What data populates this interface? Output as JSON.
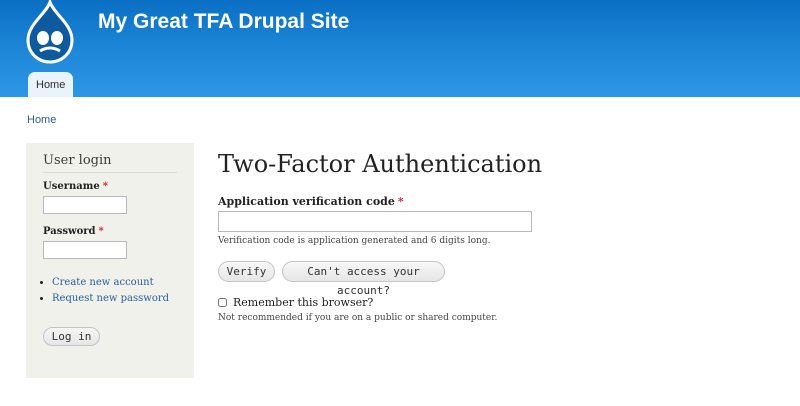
{
  "header": {
    "site_name": "My Great TFA Drupal Site",
    "logo_icon": "drupal-drop-logo-icon",
    "nav": {
      "home_tab": "Home"
    },
    "colors": {
      "gradient_top": "#0a6fc4",
      "gradient_bottom": "#2d97e6"
    }
  },
  "breadcrumb": {
    "home": "Home"
  },
  "sidebar": {
    "block_title": "User login",
    "username_label": "Username",
    "password_label": "Password",
    "required_marker": "*",
    "username_value": "",
    "password_value": "",
    "links": [
      {
        "label": "Create new account"
      },
      {
        "label": "Request new password"
      }
    ],
    "login_button": "Log in"
  },
  "main": {
    "title": "Two-Factor Authentication",
    "code_label": "Application verification code",
    "required_marker": "*",
    "code_value": "",
    "code_description": "Verification code is application generated and 6 digits long.",
    "verify_button": "Verify",
    "cant_access_button": "Can't access your account?",
    "remember_checked": false,
    "remember_label": "Remember this browser?",
    "remember_description": "Not recommended if you are on a public or shared computer."
  }
}
